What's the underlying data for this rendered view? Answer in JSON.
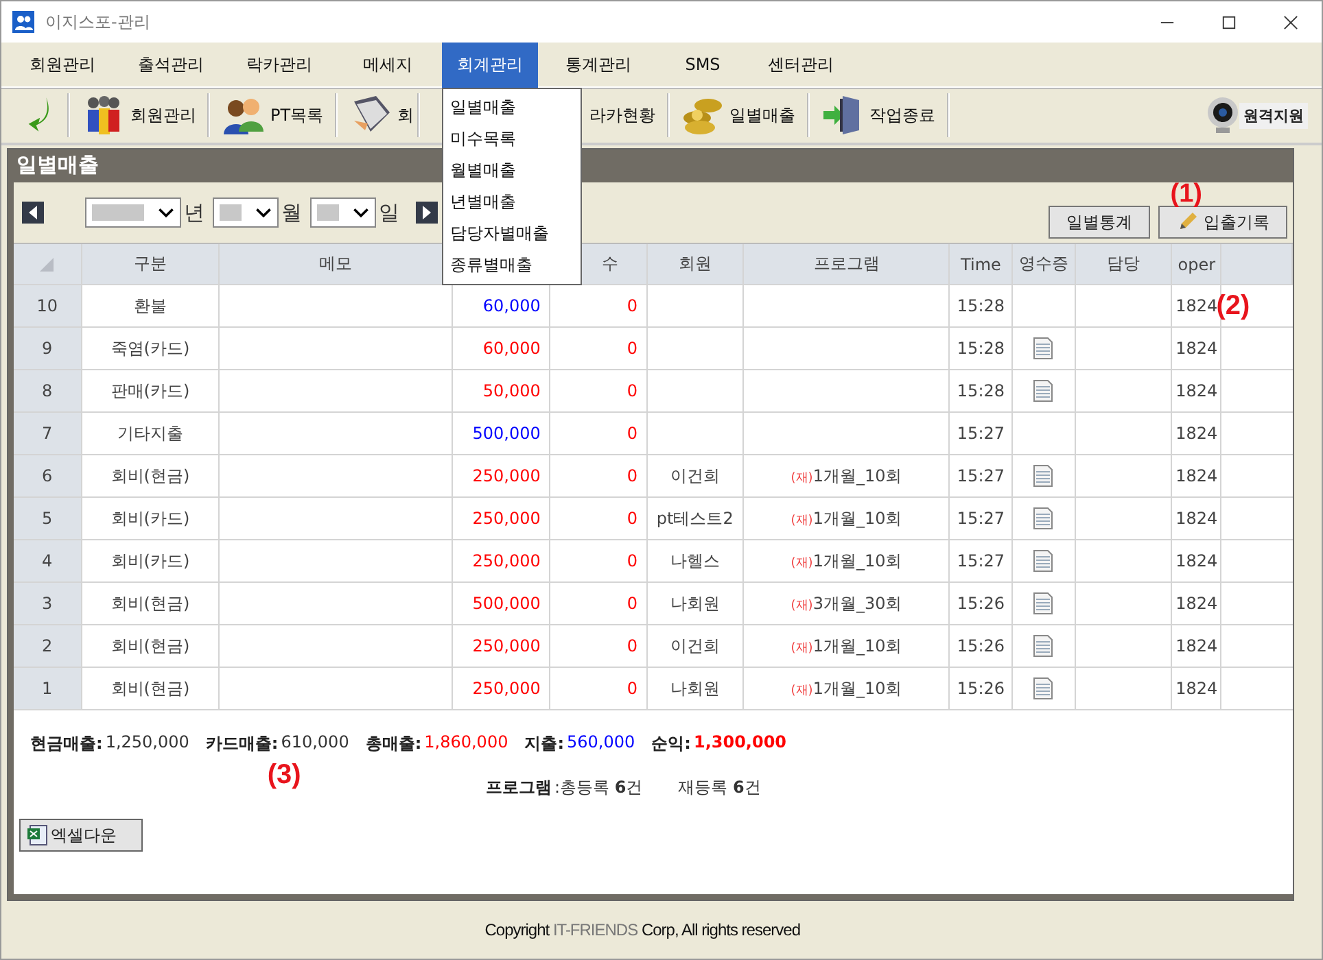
{
  "window": {
    "title": "이지스포-관리"
  },
  "menu": [
    {
      "label": "회원관리",
      "selected": false
    },
    {
      "label": "출석관리",
      "selected": false
    },
    {
      "label": "락카관리",
      "selected": false
    },
    {
      "label": "메세지",
      "selected": false
    },
    {
      "label": "회계관리",
      "selected": true
    },
    {
      "label": "통계관리",
      "selected": false
    },
    {
      "label": "SMS",
      "selected": false
    },
    {
      "label": "센터관리",
      "selected": false
    }
  ],
  "dropdown": [
    "일별매출",
    "미수목록",
    "월별매출",
    "년별매출",
    "담당자별매출",
    "종류별매출"
  ],
  "toolbar": [
    {
      "kind": "back"
    },
    {
      "kind": "members",
      "label": "회원관리"
    },
    {
      "kind": "pt",
      "label": "PT목록"
    },
    {
      "kind": "pen",
      "label": "회"
    },
    {
      "kind": "locker",
      "label": "라카현황"
    },
    {
      "kind": "coins",
      "label": "일별매출"
    },
    {
      "kind": "exit",
      "label": "작업종료"
    }
  ],
  "remote": {
    "label": "원격지원"
  },
  "panel": {
    "title": "일별매출"
  },
  "date": {
    "year_unit": "년",
    "month_unit": "월",
    "day_unit": "일"
  },
  "buttons": [
    {
      "label": "일별통계",
      "kind": "plain"
    },
    {
      "label": "입출기록",
      "kind": "icon"
    }
  ],
  "annotations": [
    "(1)",
    "(2)",
    "(3)"
  ],
  "table": {
    "columns": [
      {
        "label": "구분"
      },
      {
        "label": "메모"
      },
      {},
      {
        "label": "수"
      },
      {
        "label": "회원"
      },
      {
        "label": "프로그램"
      },
      {
        "label": "Time"
      },
      {
        "label": "영수증"
      },
      {
        "label": "담당"
      },
      {
        "label": "oper"
      },
      {}
    ],
    "rows": [
      {
        "no": "10",
        "type": "환불",
        "amount": "60,000",
        "expense": true,
        "count": "0",
        "time": "15:28",
        "receipt": false,
        "oper": "1824"
      },
      {
        "no": "9",
        "type": "죽염(카드)",
        "amount": "60,000",
        "expense": false,
        "count": "0",
        "time": "15:28",
        "receipt": true,
        "oper": "1824"
      },
      {
        "no": "8",
        "type": "판매(카드)",
        "amount": "50,000",
        "expense": false,
        "count": "0",
        "time": "15:28",
        "receipt": true,
        "oper": "1824"
      },
      {
        "no": "7",
        "type": "기타지출",
        "amount": "500,000",
        "expense": true,
        "count": "0",
        "time": "15:27",
        "receipt": false,
        "oper": "1824"
      },
      {
        "no": "6",
        "type": "회비(현금)",
        "amount": "250,000",
        "expense": false,
        "count": "0",
        "member": "이건희",
        "program_tag": "(재)",
        "program": "1개월_10회",
        "time": "15:27",
        "receipt": true,
        "oper": "1824"
      },
      {
        "no": "5",
        "type": "회비(카드)",
        "amount": "250,000",
        "expense": false,
        "count": "0",
        "member": "pt테스트2",
        "program_tag": "(재)",
        "program": "1개월_10회",
        "time": "15:27",
        "receipt": true,
        "oper": "1824"
      },
      {
        "no": "4",
        "type": "회비(카드)",
        "amount": "250,000",
        "expense": false,
        "count": "0",
        "member": "나헬스",
        "program_tag": "(재)",
        "program": "1개월_10회",
        "time": "15:27",
        "receipt": true,
        "oper": "1824"
      },
      {
        "no": "3",
        "type": "회비(현금)",
        "amount": "500,000",
        "expense": false,
        "count": "0",
        "member": "나회원",
        "program_tag": "(재)",
        "program": "3개월_30회",
        "time": "15:26",
        "receipt": true,
        "oper": "1824"
      },
      {
        "no": "2",
        "type": "회비(현금)",
        "amount": "250,000",
        "expense": false,
        "count": "0",
        "member": "이건희",
        "program_tag": "(재)",
        "program": "1개월_10회",
        "time": "15:26",
        "receipt": true,
        "oper": "1824"
      },
      {
        "no": "1",
        "type": "회비(현금)",
        "amount": "250,000",
        "expense": false,
        "count": "0",
        "member": "나회원",
        "program_tag": "(재)",
        "program": "1개월_10회",
        "time": "15:26",
        "receipt": true,
        "oper": "1824"
      }
    ]
  },
  "summary": [
    {
      "label": "현금매출:",
      "value": "1,250,000",
      "color": "#333333"
    },
    {
      "label": "카드매출:",
      "value": "610,000",
      "color": "#333333"
    },
    {
      "label": "총매출:",
      "value": "1,860,000",
      "color": "#ff0000"
    },
    {
      "label": "지출:",
      "value": "560,000",
      "color": "#0000ff"
    },
    {
      "label": "순익:",
      "value": "1,300,000",
      "color": "#ff0000"
    }
  ],
  "program_summary": {
    "label": "프로그램",
    "total": " :총등록 **6**건",
    "renew": "재등록 **6**건"
  },
  "excel_button": {
    "label": "엑셀다운"
  },
  "footer": {
    "prefix": "Copyright ",
    "company": "IT-FRIENDS",
    "suffix": " Corp,  All rights reserved"
  }
}
